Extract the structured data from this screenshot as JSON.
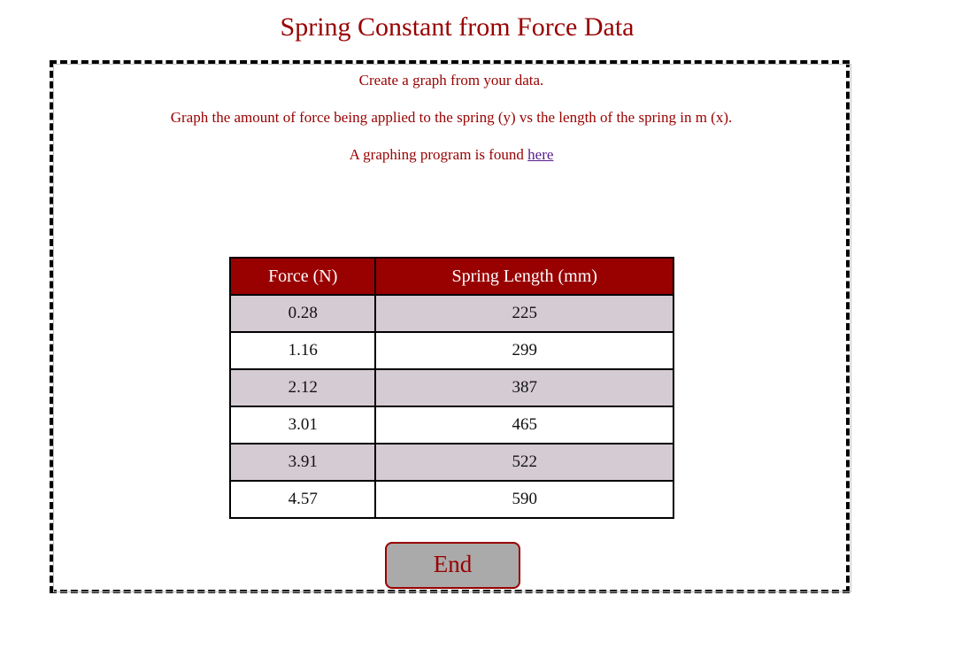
{
  "page": {
    "title": "Spring Constant from Force Data"
  },
  "instructions": {
    "line1": "Create a graph from your data.",
    "line2": "Graph the amount of force being applied to the spring (y) vs the length of the spring in m (x).",
    "line3_prefix": "A graphing program is found ",
    "line3_link": "here"
  },
  "table": {
    "headers": [
      "Force (N)",
      "Spring Length (mm)"
    ],
    "rows": [
      [
        "0.28",
        "225"
      ],
      [
        "1.16",
        "299"
      ],
      [
        "2.12",
        "387"
      ],
      [
        "3.01",
        "465"
      ],
      [
        "3.91",
        "522"
      ],
      [
        "4.57",
        "590"
      ]
    ]
  },
  "buttons": {
    "end_label": "End"
  },
  "colors": {
    "accent": "#990000",
    "row_alt": "#d5cbd3",
    "link": "#551a8b",
    "button_bg": "#aaaaaa"
  }
}
